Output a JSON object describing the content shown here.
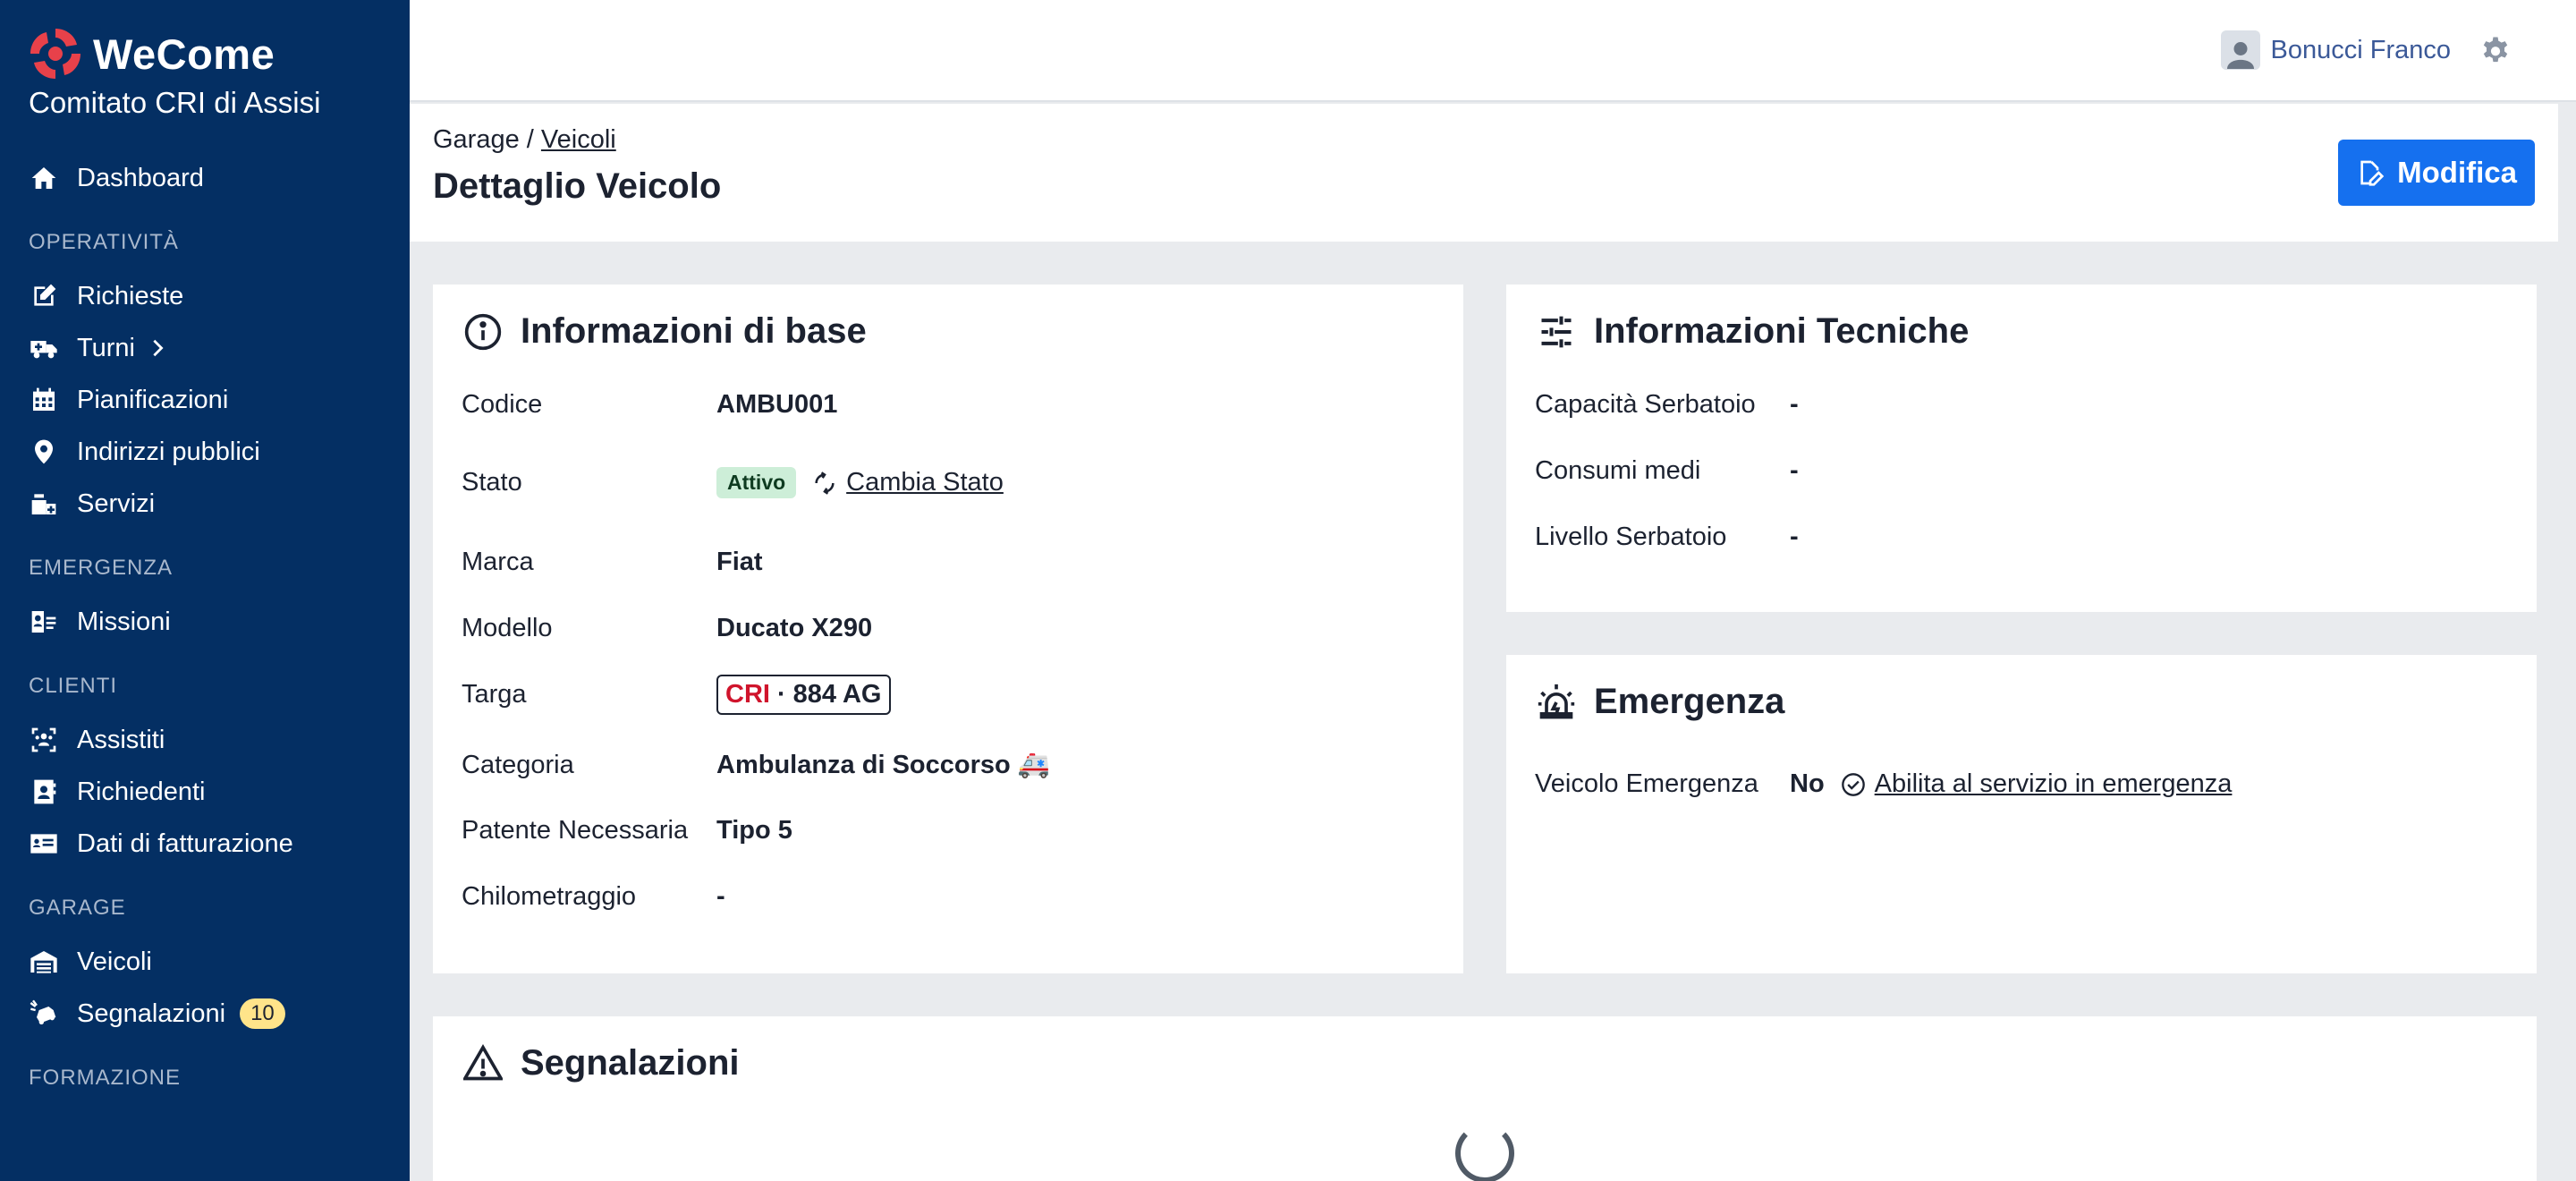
{
  "brand": {
    "name": "WeCome",
    "org": "Comitato CRI di Assisi"
  },
  "nav": {
    "dashboard": "Dashboard",
    "sections": {
      "operativita": "OPERATIVITÀ",
      "emergenza": "EMERGENZA",
      "clienti": "CLIENTI",
      "garage": "GARAGE",
      "formazione": "FORMAZIONE"
    },
    "items": {
      "richieste": "Richieste",
      "turni": "Turni",
      "pianificazioni": "Pianificazioni",
      "indirizzi": "Indirizzi pubblici",
      "servizi": "Servizi",
      "missioni": "Missioni",
      "assistiti": "Assistiti",
      "richiedenti": "Richiedenti",
      "fatturazione": "Dati di fatturazione",
      "veicoli": "Veicoli",
      "segnalazioni": "Segnalazioni",
      "segnalazioni_badge": "10"
    }
  },
  "topbar": {
    "user_name": "Bonucci Franco"
  },
  "header": {
    "breadcrumb_root": "Garage",
    "breadcrumb_sep": "/",
    "breadcrumb_link": "Veicoli",
    "title": "Dettaglio Veicolo",
    "edit_label": "Modifica"
  },
  "base_info": {
    "title": "Informazioni di base",
    "rows": [
      {
        "label": "Codice",
        "value": "AMBU001"
      },
      {
        "label": "Stato",
        "value": "Attivo",
        "action": "Cambia Stato"
      },
      {
        "label": "Marca",
        "value": "Fiat"
      },
      {
        "label": "Modello",
        "value": "Ducato X290"
      },
      {
        "label": "Targa",
        "plate_prefix": "CRI",
        "plate_sep": "·",
        "plate_number": "884 AG"
      },
      {
        "label": "Categoria",
        "value": "Ambulanza di Soccorso 🚑"
      },
      {
        "label": "Patente Necessaria",
        "value": "Tipo 5"
      },
      {
        "label": "Chilometraggio",
        "value": "-"
      }
    ]
  },
  "tech_info": {
    "title": "Informazioni Tecniche",
    "rows": [
      {
        "label": "Capacità Serbatoio",
        "value": "-"
      },
      {
        "label": "Consumi medi",
        "value": "-"
      },
      {
        "label": "Livello Serbatoio",
        "value": "-"
      }
    ]
  },
  "emergency": {
    "title": "Emergenza",
    "label": "Veicolo Emergenza",
    "value": "No",
    "action": "Abilita al servizio in emergenza"
  },
  "reports": {
    "title": "Segnalazioni"
  },
  "colors": {
    "sidebar": "#042f63",
    "primary": "#1570ef",
    "badge": "#ffe48a",
    "active_chip": "#cdeed8",
    "plate_prefix": "#d0142c"
  }
}
